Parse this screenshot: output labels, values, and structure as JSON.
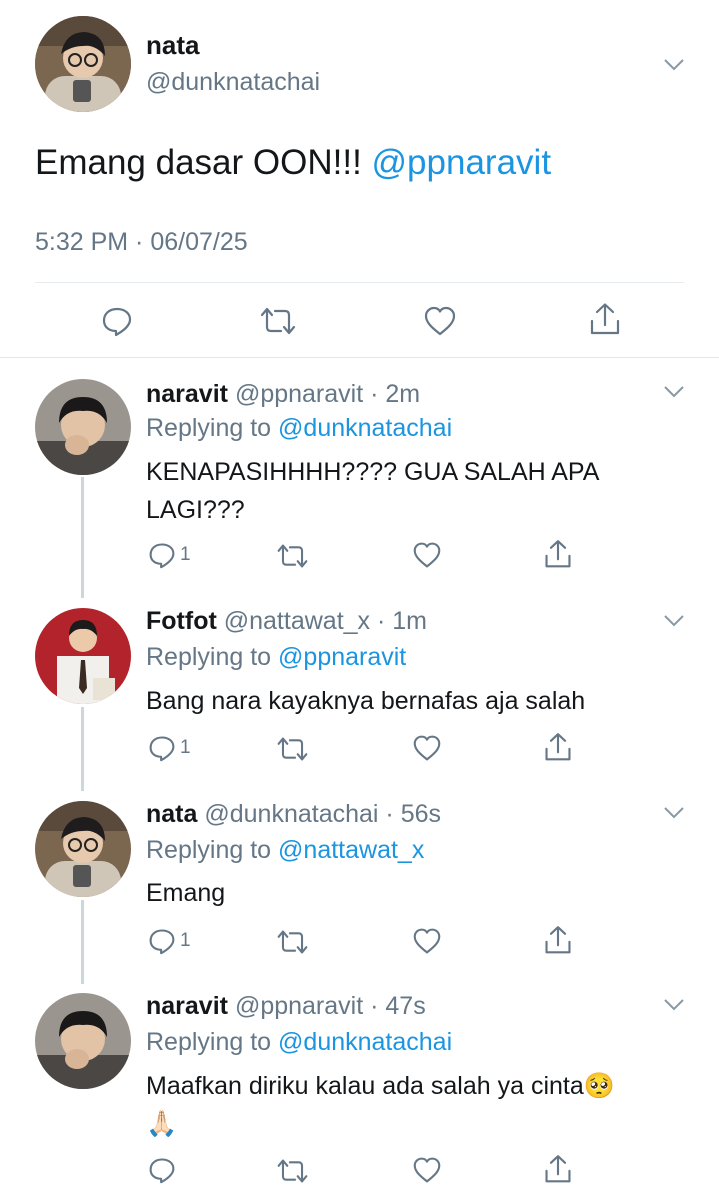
{
  "main_tweet": {
    "name": "nata",
    "handle": "@dunknatachai",
    "text": "Emang dasar OON!!!",
    "mention": "@ppnaravit",
    "timestamp": "5:32 PM · 06/07/25"
  },
  "replies": [
    {
      "name": "naravit",
      "handle": "@ppnaravit",
      "time": "2m",
      "replying_label": "Replying to",
      "replying_to": "@dunknatachai",
      "text": "KENAPASIHHHH???? GUA SALAH APA LAGI???",
      "reply_count": "1"
    },
    {
      "name": "Fotfot",
      "handle": "@nattawat_x",
      "time": "1m",
      "replying_label": "Replying to",
      "replying_to": "@ppnaravit",
      "text": "Bang nara kayaknya bernafas aja salah",
      "reply_count": "1"
    },
    {
      "name": "nata",
      "handle": "@dunknatachai",
      "time": "56s",
      "replying_label": "Replying to",
      "replying_to": "@nattawat_x",
      "text": "Emang",
      "reply_count": "1"
    },
    {
      "name": "naravit",
      "handle": "@ppnaravit",
      "time": "47s",
      "replying_label": "Replying to",
      "replying_to": "@dunknatachai",
      "text": "Maafkan diriku kalau ada salah ya cinta",
      "emoji_pleading": "🥺",
      "emoji_pray": "🙏🏻",
      "reply_count": ""
    }
  ],
  "separator": " · ",
  "colors": {
    "link": "#1b95e0",
    "muted": "#657786",
    "divider": "#e6ecf0"
  }
}
